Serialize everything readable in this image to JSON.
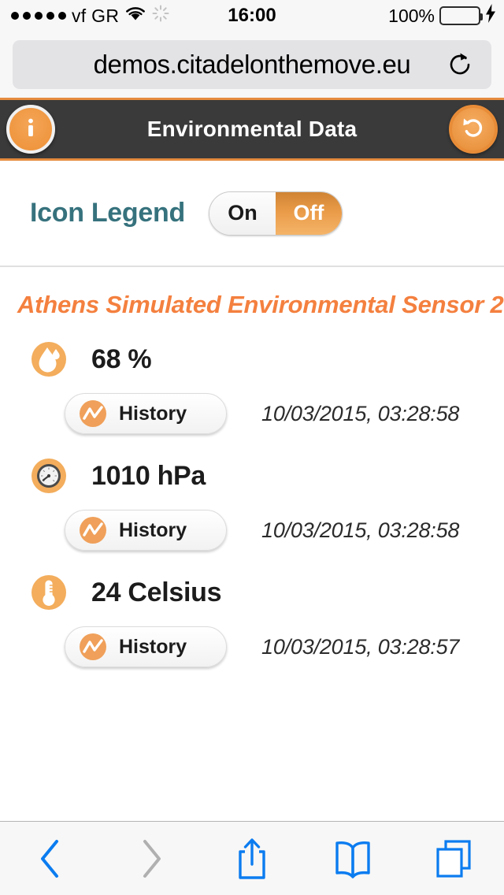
{
  "status_bar": {
    "signal_dots": 5,
    "carrier": "vf GR",
    "wifi_icon": "wifi-icon",
    "activity_icon": "activity-spinner-icon",
    "time": "16:00",
    "battery_percent": "100%",
    "battery_icon": "battery-full-icon",
    "charging_icon": "lightning-bolt-icon"
  },
  "browser": {
    "url": "demos.citadelonthemove.eu",
    "reload_icon": "reload-icon",
    "toolbar": {
      "back_icon": "chevron-left-icon",
      "forward_icon": "chevron-right-icon",
      "share_icon": "share-icon",
      "bookmarks_icon": "book-icon",
      "tabs_icon": "tabs-icon",
      "back_enabled": true,
      "forward_enabled": false,
      "enabled_color": "#0b7cf0",
      "disabled_color": "#b0b0b0"
    }
  },
  "app_header": {
    "title": "Environmental Data",
    "info_icon": "info-icon",
    "refresh_icon": "refresh-undo-icon",
    "background_color": "#3a3a3a",
    "accent_color": "#e58b3e"
  },
  "legend": {
    "label": "Icon Legend",
    "label_color": "#36727d",
    "toggle": {
      "on_label": "On",
      "off_label": "Off",
      "selected": "Off"
    }
  },
  "sensor": {
    "title": "Athens Simulated Environmental Sensor 2",
    "title_color": "#f4803f"
  },
  "readings": [
    {
      "icon": "humidity-droplet-icon",
      "value": "68 %",
      "history_label": "History",
      "history_icon": "chart-line-icon",
      "timestamp": "10/03/2015, 03:28:58"
    },
    {
      "icon": "pressure-gauge-icon",
      "value": "1010 hPa",
      "history_label": "History",
      "history_icon": "chart-line-icon",
      "timestamp": "10/03/2015, 03:28:58"
    },
    {
      "icon": "thermometer-icon",
      "value": "24 Celsius",
      "history_label": "History",
      "history_icon": "chart-line-icon",
      "timestamp": "10/03/2015, 03:28:57"
    }
  ]
}
